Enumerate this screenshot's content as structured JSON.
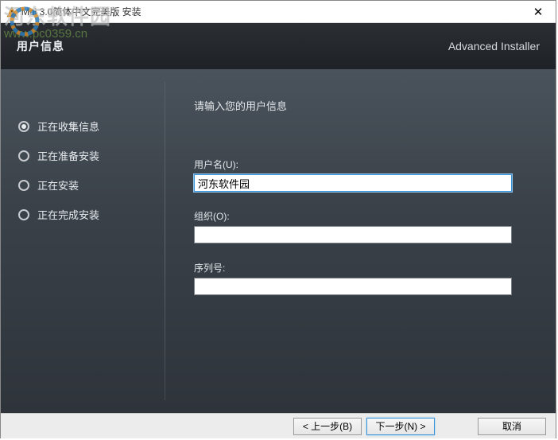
{
  "window": {
    "title": "Moi 3.0简体中文完美版 安装"
  },
  "header": {
    "title": "用户信息",
    "brand": "Advanced Installer"
  },
  "watermark": {
    "text": "河东软件园",
    "url": "www.pc0359.cn"
  },
  "sidebar": {
    "steps": [
      {
        "label": "正在收集信息",
        "active": true
      },
      {
        "label": "正在准备安装",
        "active": false
      },
      {
        "label": "正在安装",
        "active": false
      },
      {
        "label": "正在完成安装",
        "active": false
      }
    ]
  },
  "main": {
    "instruction": "请输入您的用户信息",
    "fields": {
      "username": {
        "label": "用户名(U):",
        "value": "河东软件园"
      },
      "organization": {
        "label": "组织(O):",
        "value": ""
      },
      "serial": {
        "label": "序列号:",
        "value": ""
      }
    }
  },
  "footer": {
    "back": "< 上一步(B)",
    "next": "下一步(N) >",
    "cancel": "取消"
  }
}
